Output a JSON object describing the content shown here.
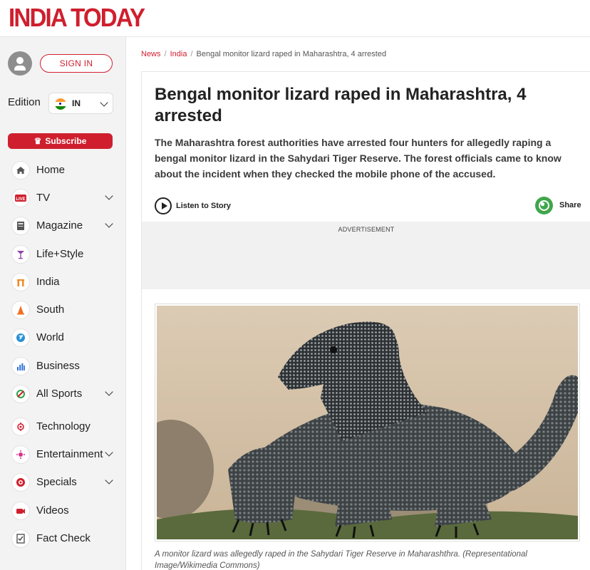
{
  "header": {
    "logo": "INDIA TODAY"
  },
  "sidebar": {
    "signin_label": "SIGN IN",
    "edition_label": "Edition",
    "edition_value": "IN",
    "subscribe_label": "Subscribe",
    "items": [
      {
        "label": "Home",
        "icon": "home-icon"
      },
      {
        "label": "TV",
        "icon": "live-tv-icon"
      },
      {
        "label": "Magazine",
        "icon": "magazine-icon"
      },
      {
        "label": "Life+Style",
        "icon": "cocktail-icon"
      },
      {
        "label": "India",
        "icon": "india-gate-icon"
      },
      {
        "label": "South",
        "icon": "temple-icon"
      },
      {
        "label": "World",
        "icon": "globe-icon"
      },
      {
        "label": "Business",
        "icon": "bar-chart-icon"
      },
      {
        "label": "All Sports",
        "icon": "sports-icon"
      },
      {
        "label": "Technology",
        "icon": "tech-icon"
      },
      {
        "label": "Entertainment",
        "icon": "entertainment-icon"
      },
      {
        "label": "Specials",
        "icon": "specials-icon"
      },
      {
        "label": "Videos",
        "icon": "video-icon"
      },
      {
        "label": "Fact Check",
        "icon": "fact-check-icon"
      }
    ]
  },
  "breadcrumb": {
    "items": [
      "News",
      "India"
    ],
    "current": "Bengal monitor lizard raped in Maharashtra, 4 arrested"
  },
  "article": {
    "title": "Bengal monitor lizard raped in Maharashtra, 4 arrested",
    "summary": "The Maharashtra forest authorities have arrested four hunters for allegedly raping a bengal monitor lizard in the Sahydari Tiger Reserve. The forest officials came to know about the incident when they checked the mobile phone of the accused.",
    "listen_label": "Listen to Story",
    "share_label": "Share",
    "ad_label": "ADVERTISEMENT",
    "caption": "A monitor lizard was allegedly raped in the Sahydari Tiger Reserve in Maharashthra. (Representational Image/Wikimedia Commons)"
  },
  "colors": {
    "brand": "#cf1f2e",
    "whatsapp": "#3fa64a"
  }
}
